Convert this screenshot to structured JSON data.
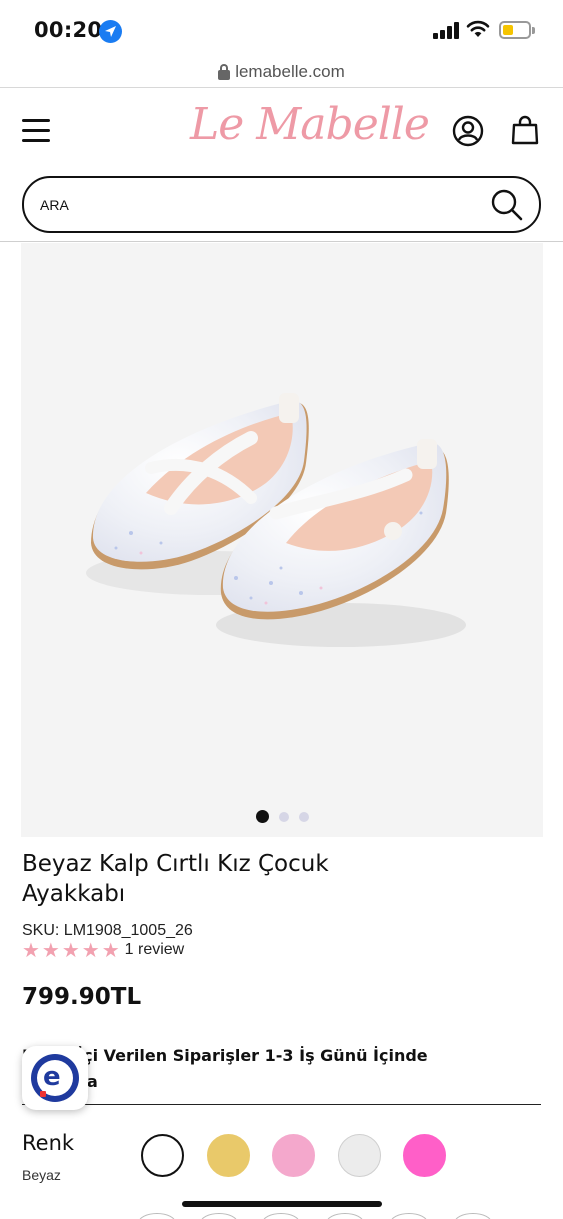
{
  "status_bar": {
    "time": "00:20"
  },
  "browser": {
    "url": "lemabelle.com"
  },
  "header": {
    "logo": "Le Mabelle"
  },
  "search": {
    "placeholder": "ARA"
  },
  "gallery": {
    "slide_count": 3,
    "active_slide": 1
  },
  "product": {
    "title_line1": "Beyaz Kalp Cırtlı Kız Çocuk",
    "title_line2": "Ayakkabı",
    "sku": "SKU: LM1908_1005_26",
    "rating": 5,
    "stars": "★★★★★",
    "reviews": "1 review",
    "price": "799.90TL"
  },
  "shipping": {
    "line1": "Hafta İçi Verilen Siparişler 1-3 İş Günü İçinde",
    "line2": "Kargoda"
  },
  "color": {
    "label": "Renk",
    "selected": "Beyaz",
    "swatches": [
      "#ffffff",
      "#e9c96a",
      "#f4a8cc",
      "#ececec",
      "#ff5fc8"
    ]
  },
  "colors": {
    "brand": "#ee9aa6",
    "location": "#1a7cf2"
  }
}
